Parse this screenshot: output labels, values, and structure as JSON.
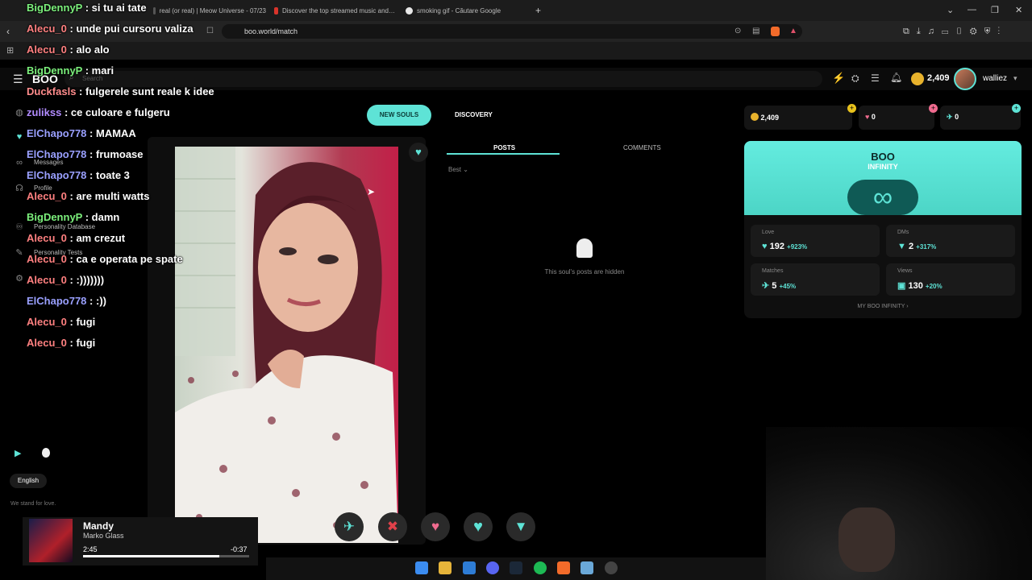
{
  "browser": {
    "tabs": [
      {
        "label": "real (or real) | Meow Universe - 07/23",
        "color": "#555"
      },
      {
        "label": "Discover the top streamed music and…",
        "color": "#d9342b"
      },
      {
        "label": "smoking gif - Căutare Google",
        "color": "#e8e8e8"
      }
    ],
    "new_tab": "+",
    "url": "boo.world/match"
  },
  "site": {
    "logo": "BOO",
    "search_placeholder": "Search",
    "coins": "2,409",
    "username": "walliez",
    "sidebar": [
      {
        "label": "Messages",
        "icon": "chat-icon"
      },
      {
        "label": "Profile",
        "icon": "profile-icon"
      },
      {
        "label": "Personality Database",
        "icon": "database-icon"
      },
      {
        "label": "Personality Tests",
        "icon": "test-icon"
      }
    ],
    "language": "English",
    "tagline": "We stand for love."
  },
  "match": {
    "tab_new_souls": "NEW SOULS",
    "tab_discovery": "DISCOVERY",
    "posts_tab": "POSTS",
    "comments_tab": "COMMENTS",
    "sort": "Best",
    "hidden_text": "This soul's posts are hidden"
  },
  "stats": {
    "coins": "2,409",
    "love_count": "0",
    "boost_count": "0",
    "card_title": "BOO",
    "card_subtitle": "INFINITY",
    "items": [
      {
        "label": "Love",
        "value": "192",
        "growth": "+923%"
      },
      {
        "label": "DMs",
        "value": "2",
        "growth": "+317%"
      },
      {
        "label": "Matches",
        "value": "5",
        "growth": "+45%"
      },
      {
        "label": "Views",
        "value": "130",
        "growth": "+20%"
      }
    ],
    "link": "MY BOO INFINITY"
  },
  "chat": [
    {
      "user": "BigDennyP",
      "text": ": si tu ai tate",
      "color": "#7cf07c"
    },
    {
      "user": "Alecu_0",
      "text": ": unde pui cursoru valiza",
      "color": "#ff8080"
    },
    {
      "user": "Alecu_0",
      "text": ": alo alo",
      "color": "#ff8080"
    },
    {
      "user": "BigDennyP",
      "text": ": mari",
      "color": "#7cf07c"
    },
    {
      "user": "Duckfasls",
      "text": ": fulgerele sunt reale k idee",
      "color": "#ff8c8c"
    },
    {
      "user": "zulikss",
      "text": ": ce culoare e fulgeru",
      "color": "#b28cff"
    },
    {
      "user": "ElChapo778",
      "text": ": MAMAA",
      "color": "#9aa0ff"
    },
    {
      "user": "ElChapo778",
      "text": ": frumoase",
      "color": "#9aa0ff"
    },
    {
      "user": "ElChapo778",
      "text": ": toate 3",
      "color": "#9aa0ff"
    },
    {
      "user": "Alecu_0",
      "text": ": are multi watts",
      "color": "#ff8080"
    },
    {
      "user": "BigDennyP",
      "text": ": damn",
      "color": "#7cf07c"
    },
    {
      "user": "Alecu_0",
      "text": ": am crezut",
      "color": "#ff8080"
    },
    {
      "user": "Alecu_0",
      "text": ": ca e operata pe spate",
      "color": "#ff8080"
    },
    {
      "user": "Alecu_0",
      "text": ": :)))))))",
      "color": "#ff8080"
    },
    {
      "user": "ElChapo778",
      "text": ": :))",
      "color": "#9aa0ff"
    },
    {
      "user": "Alecu_0",
      "text": ": fugi",
      "color": "#ff8080"
    },
    {
      "user": "Alecu_0",
      "text": ": fugi",
      "color": "#ff8080"
    }
  ],
  "music": {
    "track": "Mandy",
    "artist": "Marko Glass",
    "position": "2:45",
    "remaining": "-0:37",
    "progress": 0.82
  },
  "accent": "#5ee3d6"
}
